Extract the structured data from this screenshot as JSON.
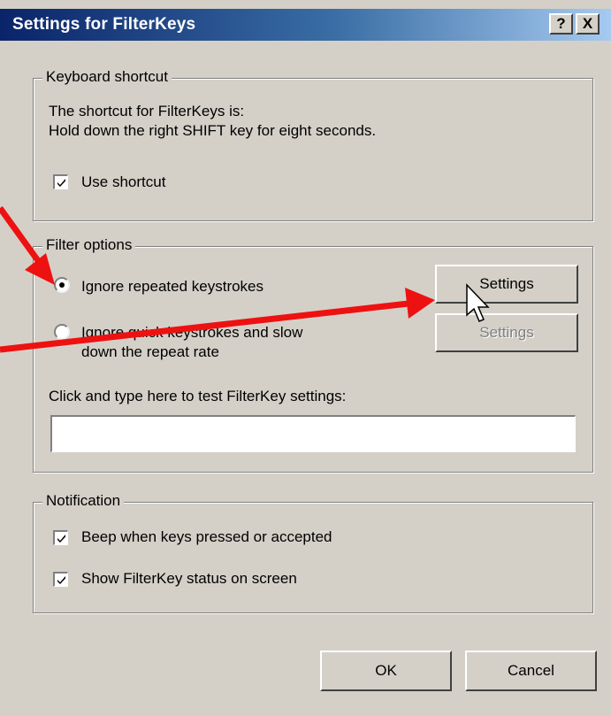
{
  "window": {
    "title": "Settings for FilterKeys",
    "help_glyph": "?",
    "close_glyph": "X"
  },
  "keyboard_shortcut": {
    "legend": "Keyboard shortcut",
    "line1": "The shortcut for FilterKeys is:",
    "line2": "Hold down the right SHIFT key for eight seconds.",
    "use_shortcut": {
      "label": "Use shortcut",
      "checked": true
    }
  },
  "filter_options": {
    "legend": "Filter options",
    "option1": {
      "label": "Ignore repeated keystrokes",
      "selected": true,
      "settings_label": "Settings",
      "settings_enabled": true
    },
    "option2": {
      "line1": "Ignore quick keystrokes and slow",
      "line2": "down the repeat rate",
      "selected": false,
      "settings_label": "Settings",
      "settings_enabled": false
    },
    "test_label": "Click and type here to test FilterKey settings:",
    "test_value": ""
  },
  "notification": {
    "legend": "Notification",
    "beep": {
      "label": "Beep when keys pressed or accepted",
      "checked": true
    },
    "show_status": {
      "label": "Show FilterKey status on screen",
      "checked": true
    }
  },
  "buttons": {
    "ok": "OK",
    "cancel": "Cancel"
  },
  "annotation": {
    "arrow_color": "#ee1111",
    "cursor": "arrow-cursor"
  }
}
